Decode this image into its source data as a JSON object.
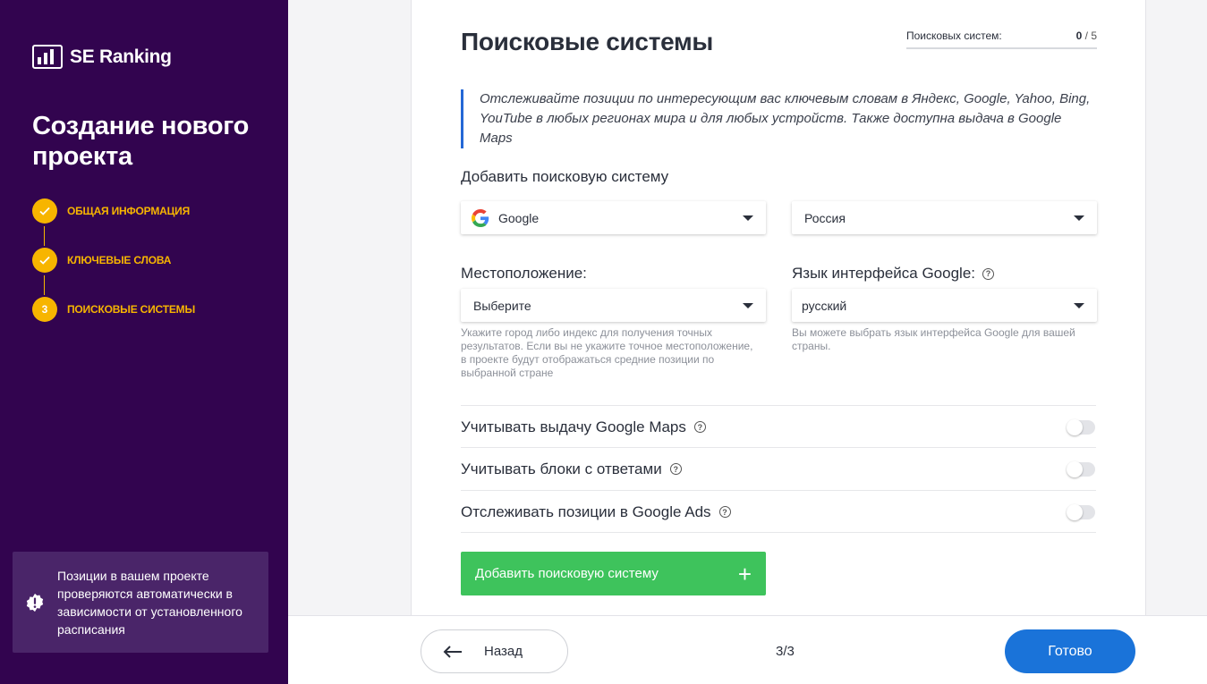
{
  "sidebar": {
    "brand": "SE Ranking",
    "title": "Создание нового проекта",
    "steps": [
      {
        "num": "",
        "label": "Общая информация",
        "state": "done"
      },
      {
        "num": "",
        "label": "Ключевые слова",
        "state": "done"
      },
      {
        "num": "3",
        "label": "Поисковые системы",
        "state": "active"
      }
    ],
    "notice": "Позиции в вашем проекте проверяются автоматически в зависимости от установленного расписания"
  },
  "main": {
    "title": "Поисковые системы",
    "counter": {
      "label": "Поисковых систем:",
      "current": "0",
      "separator": "/",
      "max": "5"
    },
    "description": "Отслеживайте позиции по интересующим вас ключевым словам в Яндекс, Google, Yahoo, Bing, YouTube в любых регионах мира и для любых устройств. Также доступна выдача в Google Maps",
    "add_label": "Добавить поисковую систему",
    "search_engine_select": "Google",
    "country_select": "Россия",
    "location": {
      "label": "Местоположение:",
      "value": "Выберите",
      "hint": "Укажите город либо индекс для получения точных результатов. Если вы не укажите точное местоположение, в проекте будут отображаться средние позиции по выбранной стране"
    },
    "language": {
      "label": "Язык интерфейса Google:",
      "value": "русский",
      "hint": "Вы можете выбрать язык интерфейса Google для вашей страны."
    },
    "toggles": [
      {
        "label": "Учитывать выдачу Google Maps",
        "on": false
      },
      {
        "label": "Учитывать блоки с ответами",
        "on": false
      },
      {
        "label": "Отслеживать позиции в Google Ads",
        "on": false
      }
    ],
    "add_button": "Добавить поисковую систему",
    "add_button_icon": "+"
  },
  "footer": {
    "back": "Назад",
    "pager": "3/3",
    "done": "Готово"
  },
  "colors": {
    "sidebar_bg": "#32044f",
    "step_accent": "#f7b500",
    "add_button": "#3ec35c",
    "done_button": "#1a73d9"
  }
}
